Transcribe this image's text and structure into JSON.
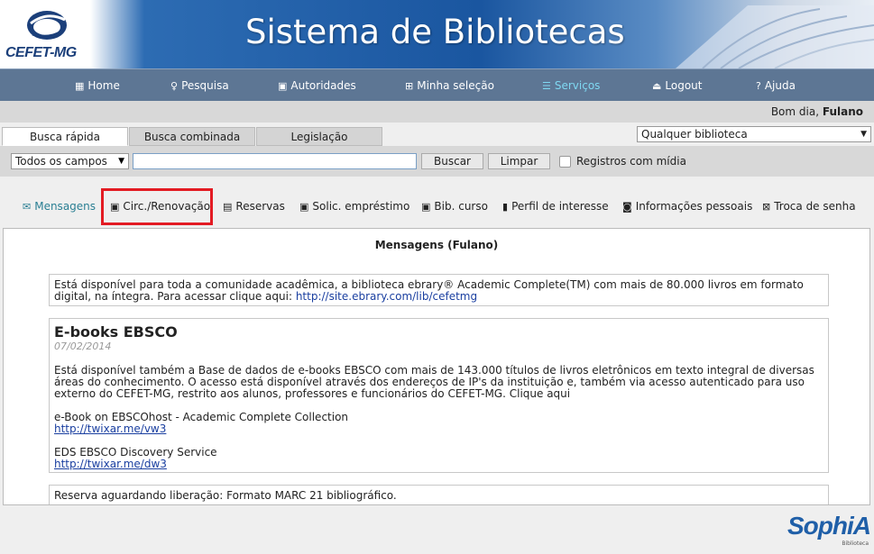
{
  "header": {
    "title": "Sistema de Bibliotecas",
    "logo_text": "CEFET-MG",
    "brand_color": "#1f5fa8"
  },
  "nav": {
    "items": [
      {
        "label": "Home",
        "icon": "home-icon"
      },
      {
        "label": "Pesquisa",
        "icon": "search-icon"
      },
      {
        "label": "Autoridades",
        "icon": "authority-icon"
      },
      {
        "label": "Minha seleção",
        "icon": "grid-icon"
      },
      {
        "label": "Serviços",
        "icon": "services-icon",
        "active": true
      },
      {
        "label": "Logout",
        "icon": "logout-icon"
      },
      {
        "label": "Ajuda",
        "icon": "help-icon"
      }
    ],
    "active_color": "#7fd8f2"
  },
  "greeting": {
    "prefix": "Bom dia,",
    "user": "Fulano"
  },
  "search": {
    "tabs": [
      "Busca rápida",
      "Busca combinada",
      "Legislação"
    ],
    "library_select": "Qualquer biblioteca",
    "field_select": "Todos os campos",
    "query": "",
    "search_button": "Buscar",
    "clear_button": "Limpar",
    "media_checkbox_label": "Registros com mídia"
  },
  "services": {
    "items": [
      {
        "label": "Mensagens",
        "icon": "mail-icon",
        "active": true
      },
      {
        "label": "Circ./Renovação",
        "icon": "circulation-icon"
      },
      {
        "label": "Reservas",
        "icon": "reserve-icon"
      },
      {
        "label": "Solic. empréstimo",
        "icon": "loan-icon"
      },
      {
        "label": "Bib. curso",
        "icon": "course-icon"
      },
      {
        "label": "Perfil de interesse",
        "icon": "profile-icon"
      },
      {
        "label": "Informações pessoais",
        "icon": "person-icon"
      },
      {
        "label": "Troca de senha",
        "icon": "password-icon"
      }
    ],
    "highlight_color": "#e31b23"
  },
  "content": {
    "title": "Mensagens (Fulano)",
    "msg1": {
      "text": "Está disponível para toda a comunidade acadêmica, a biblioteca ebrary® Academic Complete(TM) com mais de 80.000 livros em formato digital, na íntegra. Para acessar clique aqui:",
      "link": "http://site.ebrary.com/lib/cefetmg"
    },
    "msg2": {
      "heading": "E-books EBSCO",
      "date": "07/02/2014",
      "text": "Está disponível também a Base de dados de e-books EBSCO com mais de 143.000 títulos de livros eletrônicos em texto integral de diversas áreas do conhecimento. O acesso está disponível através dos endereços de IP's da instituição e, também via acesso autenticado para uso externo do CEFET-MG, restrito aos alunos, professores e funcionários do CEFET-MG. Clique aqui",
      "item1_label": "e-Book on EBSCOhost - Academic Complete Collection",
      "item1_link": "http://twixar.me/vw3",
      "item2_label": "EDS EBSCO Discovery Service",
      "item2_link": "http://twixar.me/dw3"
    },
    "msg3": {
      "text": "Reserva aguardando liberação: Formato MARC 21 bibliográfico."
    }
  },
  "footer": {
    "brand": "SophiA",
    "brand_sub": "Biblioteca"
  }
}
